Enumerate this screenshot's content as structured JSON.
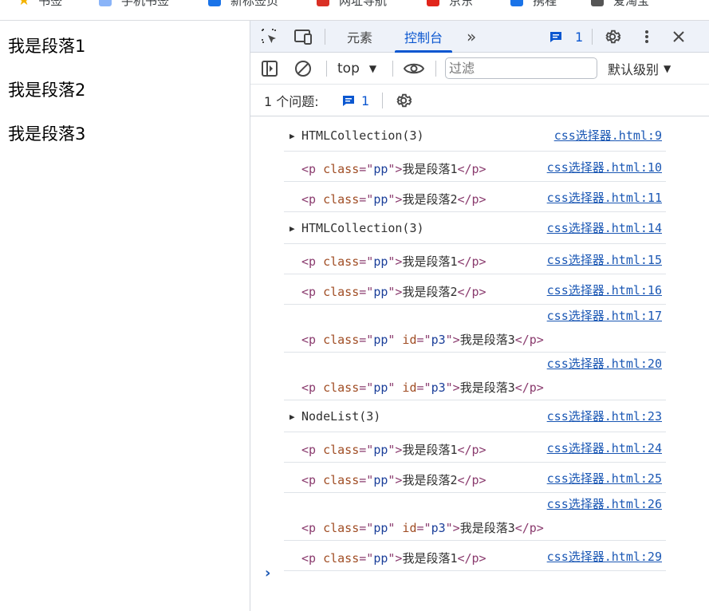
{
  "bookmarks": [
    {
      "label": "书签",
      "icon": "star-icon",
      "color": "#f4b400"
    },
    {
      "label": "手机书签",
      "icon": "mobile-bookmark-icon",
      "color": "#8ab4f8"
    },
    {
      "label": "新标签页",
      "icon": "newtab-icon",
      "color": "#1a73e8"
    },
    {
      "label": "网址导航",
      "icon": "hao123-icon",
      "color": "#d93025"
    },
    {
      "label": "京东",
      "icon": "jd-icon",
      "color": "#e1251b"
    },
    {
      "label": "携程",
      "icon": "ctrip-icon",
      "color": "#1a73e8"
    },
    {
      "label": "爱淘宝",
      "icon": "taobao-icon",
      "color": "#555555"
    }
  ],
  "page": {
    "paragraphs": [
      "我是段落1",
      "我是段落2",
      "我是段落3"
    ]
  },
  "devtools": {
    "tabs": [
      {
        "label": "元素",
        "active": false
      },
      {
        "label": "控制台",
        "active": true
      }
    ],
    "more_tabs_glyph": "»",
    "issues_badge_count": "1",
    "context": "top",
    "filter_placeholder": "过滤",
    "level_label": "默认级别",
    "issues_label": "1 个问题:",
    "issues_count": "1"
  },
  "console": {
    "entries": [
      {
        "kind": "collection",
        "text": "HTMLCollection(3)",
        "source": "css选择器.html:9"
      },
      {
        "kind": "element",
        "cls": "pp",
        "id": "",
        "content": "我是段落1",
        "source": "css选择器.html:10"
      },
      {
        "kind": "element",
        "cls": "pp",
        "id": "",
        "content": "我是段落2",
        "source": "css选择器.html:11"
      },
      {
        "kind": "collection",
        "text": "HTMLCollection(3)",
        "source": "css选择器.html:14"
      },
      {
        "kind": "element",
        "cls": "pp",
        "id": "",
        "content": "我是段落1",
        "source": "css选择器.html:15"
      },
      {
        "kind": "element",
        "cls": "pp",
        "id": "",
        "content": "我是段落2",
        "source": "css选择器.html:16"
      },
      {
        "kind": "element",
        "cls": "pp",
        "id": "p3",
        "content": "我是段落3",
        "source": "css选择器.html:17"
      },
      {
        "kind": "element",
        "cls": "pp",
        "id": "p3",
        "content": "我是段落3",
        "source": "css选择器.html:20"
      },
      {
        "kind": "collection",
        "text": "NodeList(3)",
        "source": "css选择器.html:23"
      },
      {
        "kind": "element",
        "cls": "pp",
        "id": "",
        "content": "我是段落1",
        "source": "css选择器.html:24"
      },
      {
        "kind": "element",
        "cls": "pp",
        "id": "",
        "content": "我是段落2",
        "source": "css选择器.html:25"
      },
      {
        "kind": "element",
        "cls": "pp",
        "id": "p3",
        "content": "我是段落3",
        "source": "css选择器.html:26"
      },
      {
        "kind": "element",
        "cls": "pp",
        "id": "",
        "content": "我是段落1",
        "source": "css选择器.html:29"
      }
    ],
    "prompt_glyph": "›"
  },
  "colors": {
    "accent": "#0b57d0",
    "link": "#1a57b4",
    "tag": "#8a3b6e",
    "attr_name": "#a04d24",
    "attr_value": "#1b3f9a",
    "tabbar_bg": "#eef2f9"
  }
}
